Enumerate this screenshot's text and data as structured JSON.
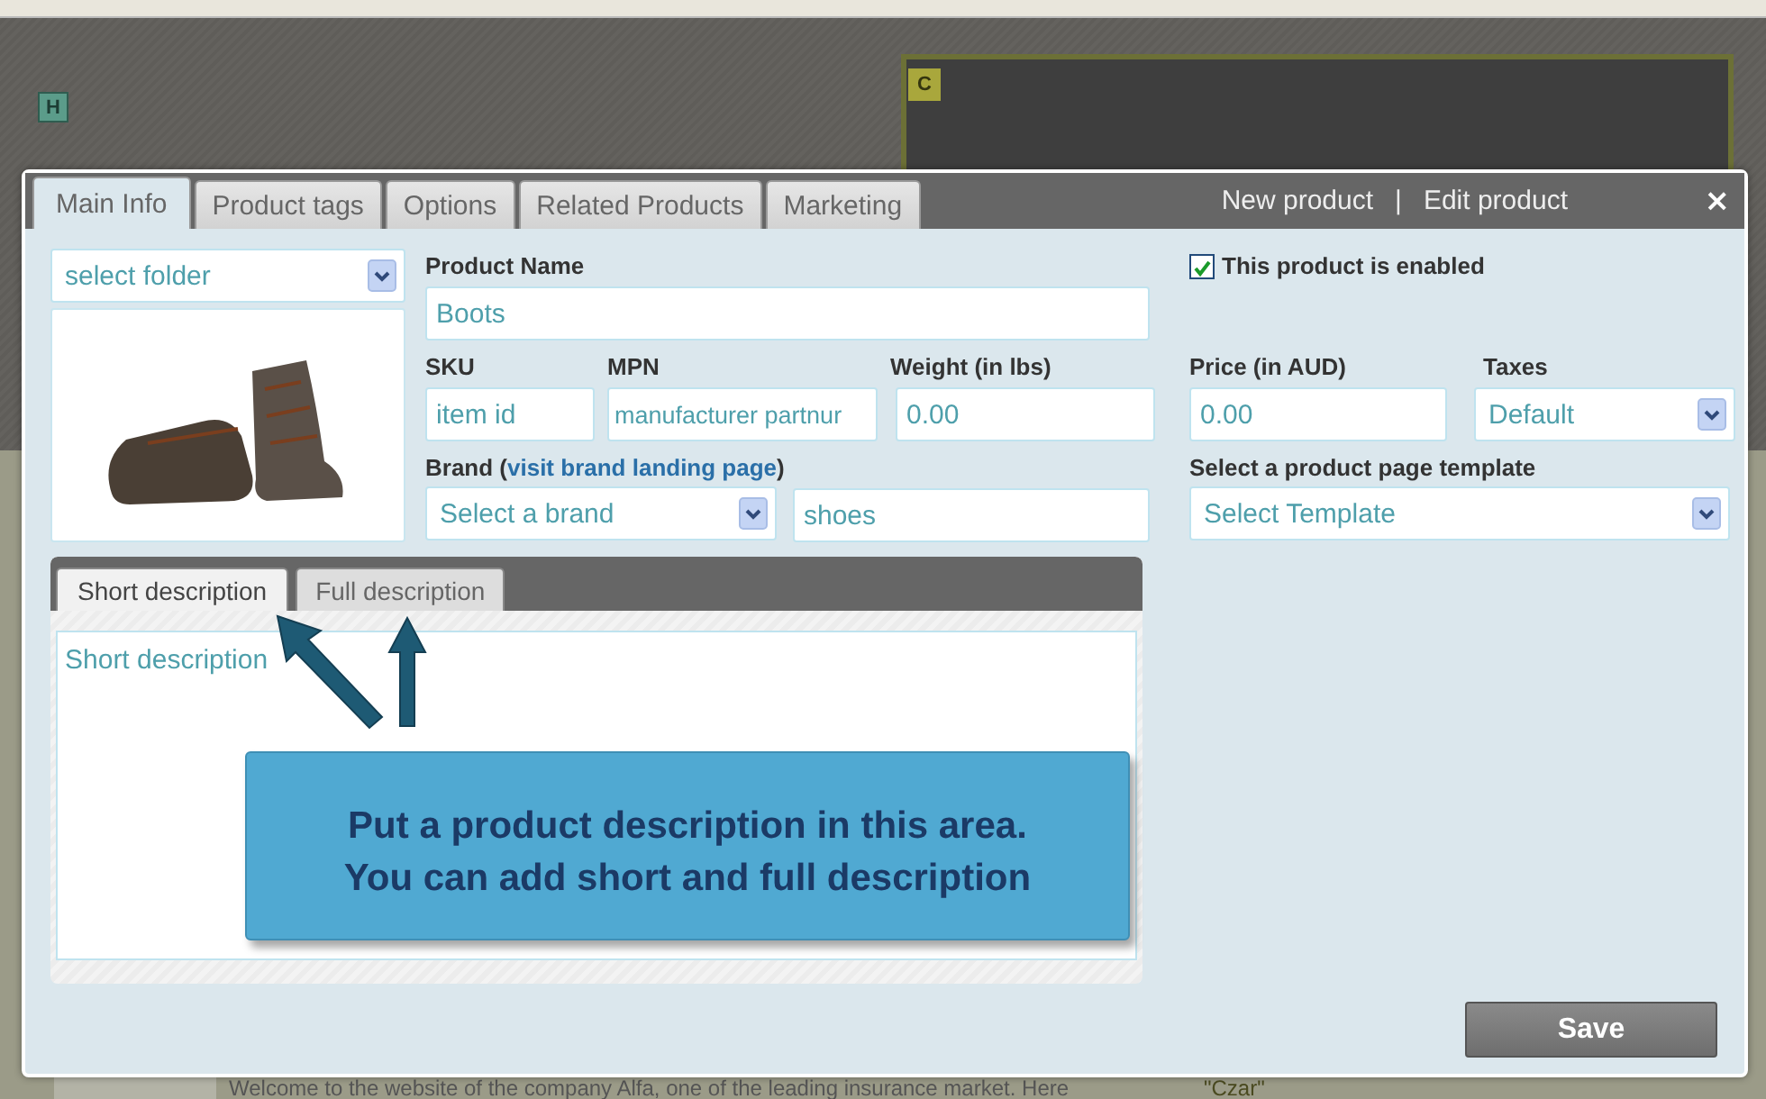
{
  "backdrop": {
    "badges": [
      {
        "label": "H",
        "color": "#5b9c8a"
      },
      {
        "label": "C",
        "color": "#a9a73c"
      }
    ],
    "texts": [
      "Welcome to the website of the company Alfa, one of the leading insurance market. Here",
      "\"Czar\""
    ]
  },
  "dialog": {
    "tabs": [
      {
        "label": "Main Info",
        "selected": true
      },
      {
        "label": "Product tags",
        "selected": false
      },
      {
        "label": "Options",
        "selected": false
      },
      {
        "label": "Related Products",
        "selected": false
      },
      {
        "label": "Marketing",
        "selected": false
      }
    ],
    "header_links": [
      "New product",
      "Edit product"
    ],
    "separator": "|",
    "close": "×",
    "folder_select": {
      "value": "select folder"
    },
    "product_name": {
      "label": "Product Name",
      "value": "Boots"
    },
    "sku": {
      "label": "SKU",
      "placeholder": "item id"
    },
    "mpn": {
      "label": "MPN",
      "placeholder": "manufacturer partnur"
    },
    "weight": {
      "label": "Weight (in lbs)",
      "value": "0.00"
    },
    "brand": {
      "prefix": "Brand (",
      "link": "visit brand landing page",
      "suffix": ")",
      "select": "Select a brand",
      "tags": "shoes"
    },
    "enabled": {
      "label": "This product is enabled",
      "checked": true
    },
    "price": {
      "label": "Price (in AUD)",
      "value": "0.00"
    },
    "taxes": {
      "label": "Taxes",
      "value": "Default"
    },
    "template": {
      "label": "Select a product page template",
      "value": "Select Template"
    },
    "description": {
      "tabs": [
        {
          "label": "Short description",
          "selected": true
        },
        {
          "label": "Full description",
          "selected": false
        }
      ],
      "placeholder": "Short description",
      "callout": [
        "Put a product description in this area.",
        "You can add short and full description"
      ]
    },
    "save": "Save"
  }
}
